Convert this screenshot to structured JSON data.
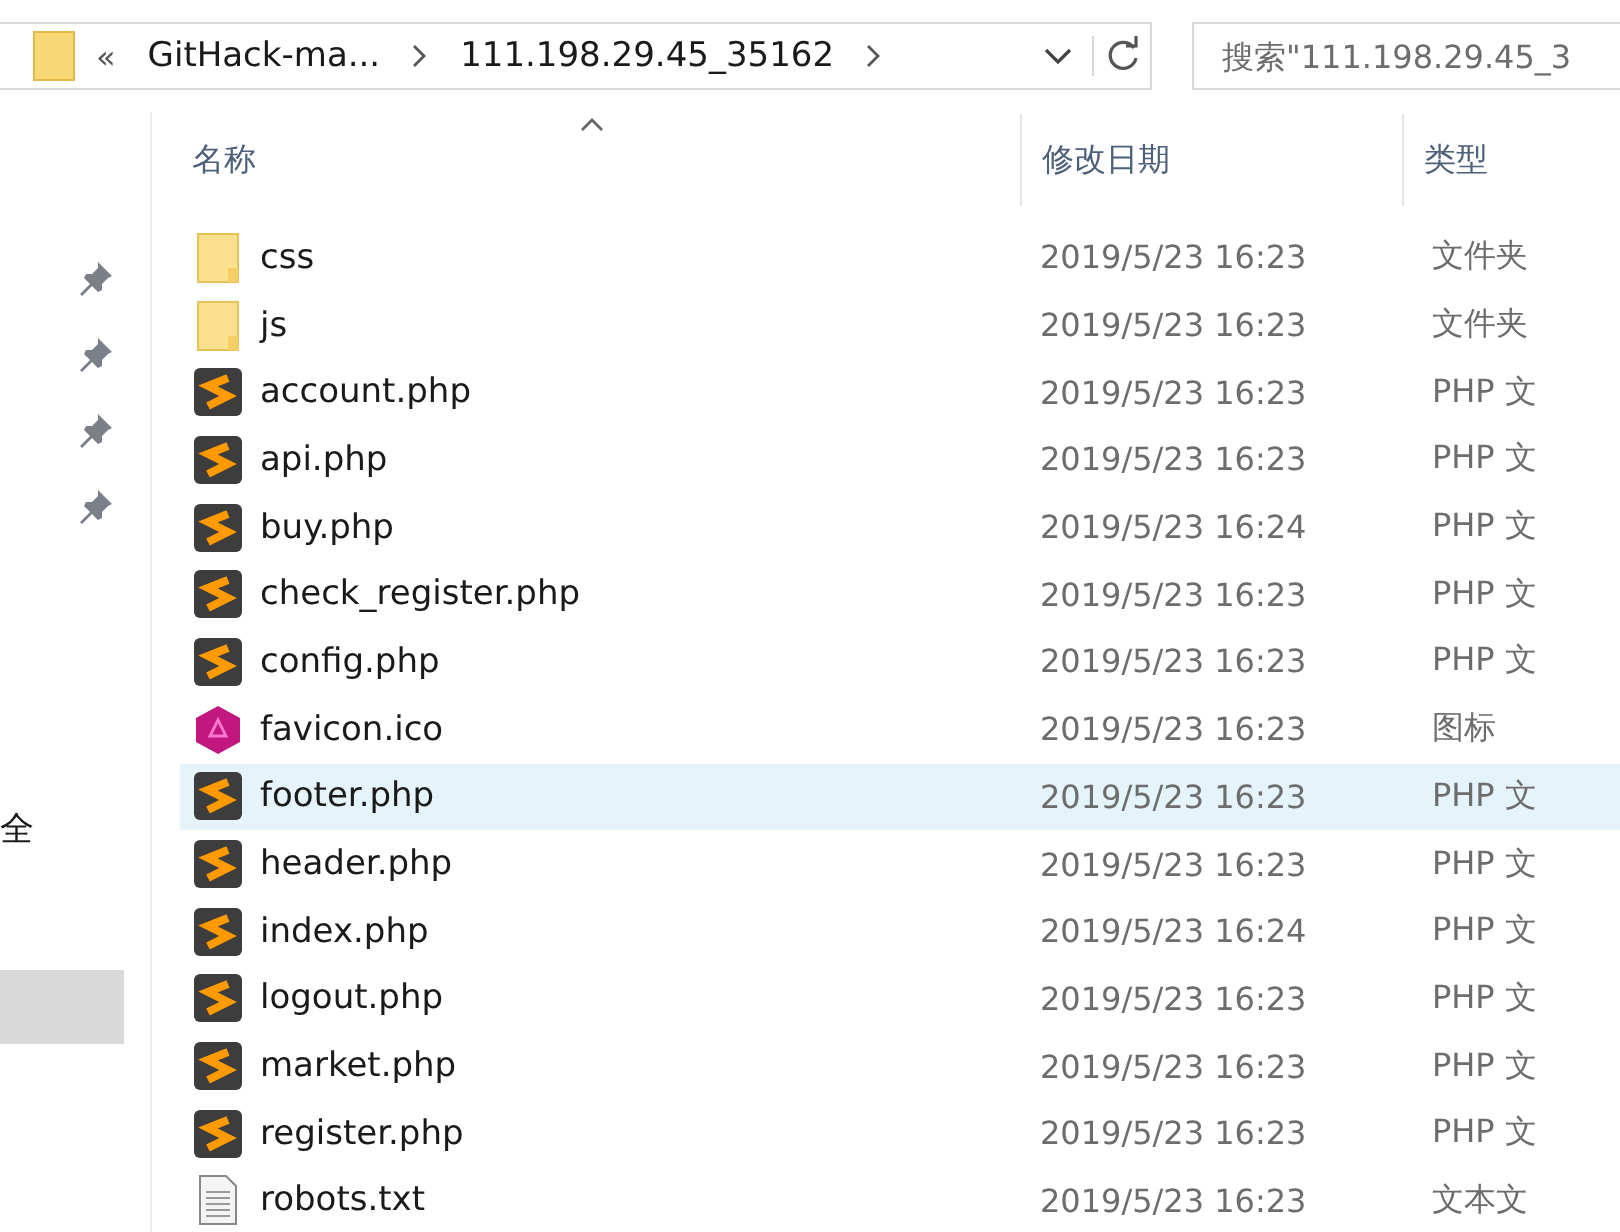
{
  "address_bar": {
    "overflow": "«",
    "crumbs": [
      "GitHack-ma...",
      "111.198.29.45_35162"
    ]
  },
  "search": {
    "placeholder": "搜索\"111.198.29.45_3"
  },
  "sidebar": {
    "items": [
      {
        "label": "全",
        "selected": false
      },
      {
        "selected": true
      }
    ]
  },
  "columns": [
    "名称",
    "修改日期",
    "类型"
  ],
  "files": [
    {
      "name": "css",
      "date": "2019/5/23 16:23",
      "type": "文件夹",
      "kind": "folder",
      "selected": false
    },
    {
      "name": "js",
      "date": "2019/5/23 16:23",
      "type": "文件夹",
      "kind": "folder",
      "selected": false
    },
    {
      "name": "account.php",
      "date": "2019/5/23 16:23",
      "type": "PHP 文",
      "kind": "php",
      "selected": false
    },
    {
      "name": "api.php",
      "date": "2019/5/23 16:23",
      "type": "PHP 文",
      "kind": "php",
      "selected": false
    },
    {
      "name": "buy.php",
      "date": "2019/5/23 16:24",
      "type": "PHP 文",
      "kind": "php",
      "selected": false
    },
    {
      "name": "check_register.php",
      "date": "2019/5/23 16:23",
      "type": "PHP 文",
      "kind": "php",
      "selected": false
    },
    {
      "name": "config.php",
      "date": "2019/5/23 16:23",
      "type": "PHP 文",
      "kind": "php",
      "selected": false
    },
    {
      "name": "favicon.ico",
      "date": "2019/5/23 16:23",
      "type": "图标",
      "kind": "icon",
      "selected": false
    },
    {
      "name": "footer.php",
      "date": "2019/5/23 16:23",
      "type": "PHP 文",
      "kind": "php",
      "selected": true
    },
    {
      "name": "header.php",
      "date": "2019/5/23 16:23",
      "type": "PHP 文",
      "kind": "php",
      "selected": false
    },
    {
      "name": "index.php",
      "date": "2019/5/23 16:24",
      "type": "PHP 文",
      "kind": "php",
      "selected": false
    },
    {
      "name": "logout.php",
      "date": "2019/5/23 16:23",
      "type": "PHP 文",
      "kind": "php",
      "selected": false
    },
    {
      "name": "market.php",
      "date": "2019/5/23 16:23",
      "type": "PHP 文",
      "kind": "php",
      "selected": false
    },
    {
      "name": "register.php",
      "date": "2019/5/23 16:23",
      "type": "PHP 文",
      "kind": "php",
      "selected": false
    },
    {
      "name": "robots.txt",
      "date": "2019/5/23 16:23",
      "type": "文本文",
      "kind": "text",
      "selected": false
    }
  ]
}
